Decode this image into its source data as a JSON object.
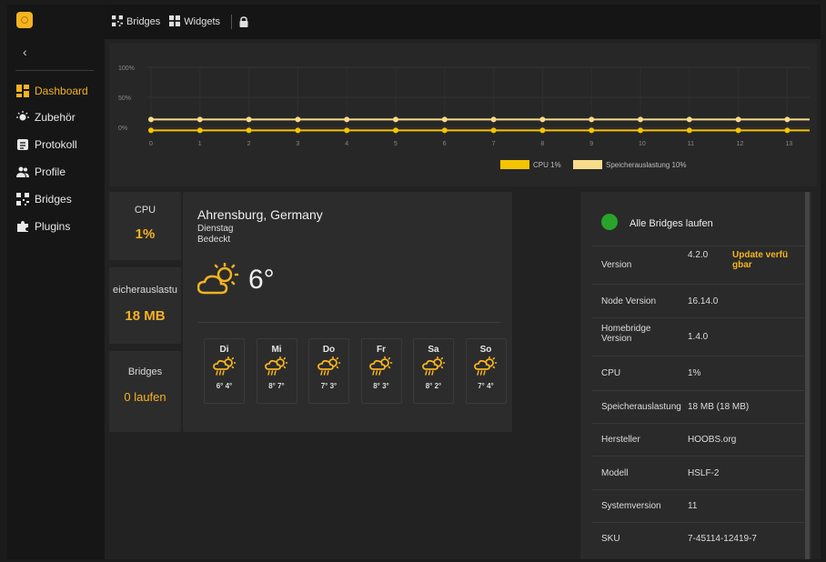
{
  "colors": {
    "accent": "#f5b321",
    "cpu_series": "#f5c400",
    "memory_series": "#f7dc8a",
    "status_ok": "#29a329"
  },
  "sidebar": {
    "collapse_icon": "chevron-left-icon",
    "items": [
      {
        "label": "Dashboard",
        "icon": "dashboard-icon",
        "active": true
      },
      {
        "label": "Zubehör",
        "icon": "lightbulb-icon",
        "active": false
      },
      {
        "label": "Protokoll",
        "icon": "log-icon",
        "active": false
      },
      {
        "label": "Profile",
        "icon": "users-icon",
        "active": false
      },
      {
        "label": "Bridges",
        "icon": "qr-icon",
        "active": false
      },
      {
        "label": "Plugins",
        "icon": "puzzle-icon",
        "active": false
      }
    ]
  },
  "topbar": {
    "bridges_label": "Bridges",
    "widgets_label": "Widgets",
    "lock_icon": "lock-icon"
  },
  "chart_data": {
    "type": "line",
    "x": [
      0,
      1,
      2,
      3,
      4,
      5,
      6,
      7,
      8,
      9,
      10,
      11,
      12,
      13
    ],
    "yticks": [
      "100%",
      "50%",
      "0%"
    ],
    "ylim": [
      0,
      100
    ],
    "series": [
      {
        "name": "CPU 1%",
        "values": [
          1,
          1,
          1,
          1,
          1,
          1,
          1,
          1,
          1,
          1,
          1,
          1,
          1,
          1
        ]
      },
      {
        "name": "Speicherauslastung 10%",
        "values": [
          10,
          10,
          10,
          10,
          10,
          10,
          10,
          10,
          10,
          10,
          10,
          10,
          10,
          10
        ]
      }
    ],
    "legend": "bottom-center"
  },
  "stats": {
    "cpu": {
      "label": "CPU",
      "value": "1%"
    },
    "memory": {
      "label": "eicherauslastu",
      "value": "18 MB"
    },
    "bridges": {
      "label": "Bridges",
      "value": "0 laufen"
    }
  },
  "weather": {
    "city": "Ahrensburg, Germany",
    "day": "Dienstag",
    "condition": "Bedeckt",
    "temperature": "6°",
    "forecast": [
      {
        "day": "Di",
        "temps": "6° 4°"
      },
      {
        "day": "Mi",
        "temps": "8° 7°"
      },
      {
        "day": "Do",
        "temps": "7° 3°"
      },
      {
        "day": "Fr",
        "temps": "8° 3°"
      },
      {
        "day": "Sa",
        "temps": "8° 2°"
      },
      {
        "day": "So",
        "temps": "7° 4°"
      }
    ]
  },
  "info": {
    "status": "Alle Bridges laufen",
    "rows": [
      {
        "key": "Version",
        "value": "4.2.0",
        "link": "Update verfü gbar"
      },
      {
        "key": "Node Version",
        "value": "16.14.0"
      },
      {
        "key": "Homebridge Version",
        "value": "1.4.0"
      },
      {
        "key": "CPU",
        "value": "1%"
      },
      {
        "key": "Speicherauslastung",
        "value": "18 MB (18 MB)"
      },
      {
        "key": "Hersteller",
        "value": "HOOBS.org"
      },
      {
        "key": "Modell",
        "value": "HSLF-2"
      },
      {
        "key": "Systemversion",
        "value": "11"
      },
      {
        "key": "SKU",
        "value": "7-45114-12419-7"
      }
    ]
  }
}
